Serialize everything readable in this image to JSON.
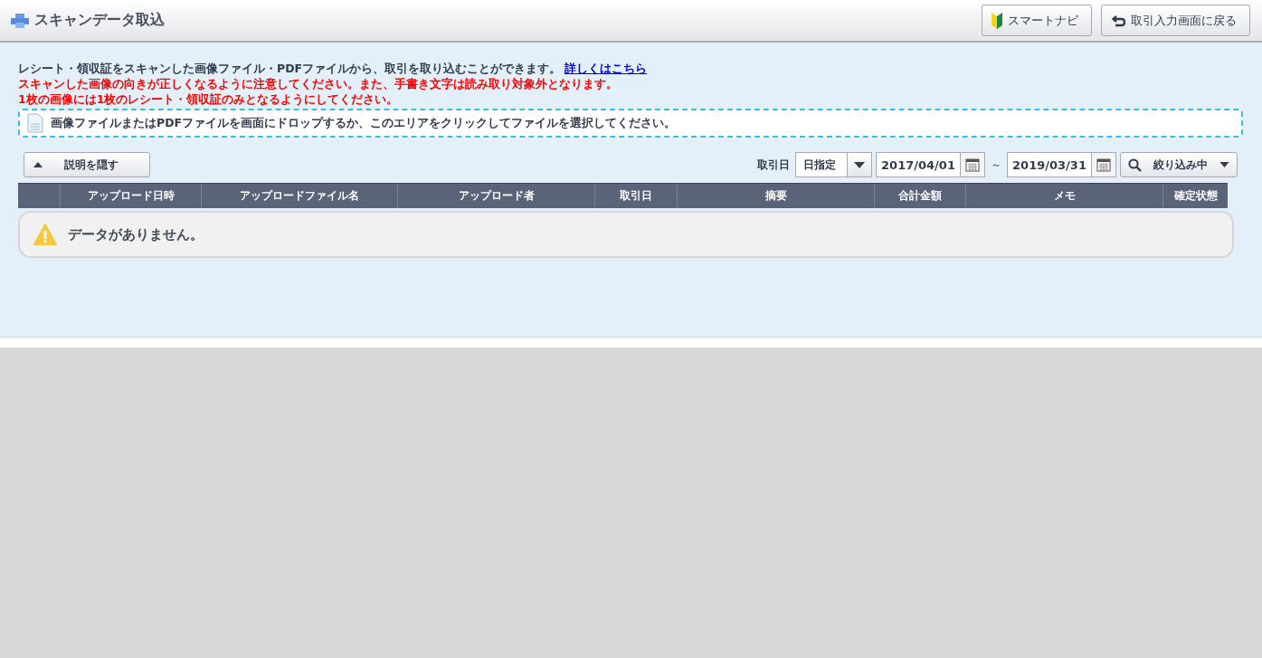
{
  "header": {
    "title": "スキャンデータ取込",
    "buttons": [
      {
        "kind": "navi",
        "label": "スマートナビ"
      },
      {
        "kind": "back",
        "label": "取引入力画面に戻る"
      }
    ]
  },
  "description": {
    "lines": [
      {
        "text": "レシート・領収証をスキャンした画像ファイル・PDFファイルから、取引を取り込むことができます。",
        "link": "詳しくはこちら",
        "warning": false
      },
      {
        "text": "スキャンした画像の向きが正しくなるように注意してください。また、手書き文字は読み取り対象外となります。",
        "warning": true
      },
      {
        "text": "1枚の画像には1枚のレシート・領収証のみとなるようにしてください。",
        "warning": true
      }
    ]
  },
  "drop_zone": {
    "text": "画像ファイルまたはPDFファイルを画面にドロップするか、このエリアをクリックしてファイルを選択してください。"
  },
  "toolbar": {
    "hide_button": "説明を隠す",
    "filter_label": "取引日",
    "date_mode": "日指定",
    "date_from": "2017/04/01",
    "range_separator": "～",
    "date_to": "2019/03/31",
    "filter_button": "絞り込み中"
  },
  "table": {
    "columns": [
      "アップロード日時",
      "アップロードファイル名",
      "アップロード者",
      "取引日",
      "摘要",
      "合計金額",
      "メモ",
      "確定状態"
    ],
    "empty_message": "データがありません。"
  }
}
